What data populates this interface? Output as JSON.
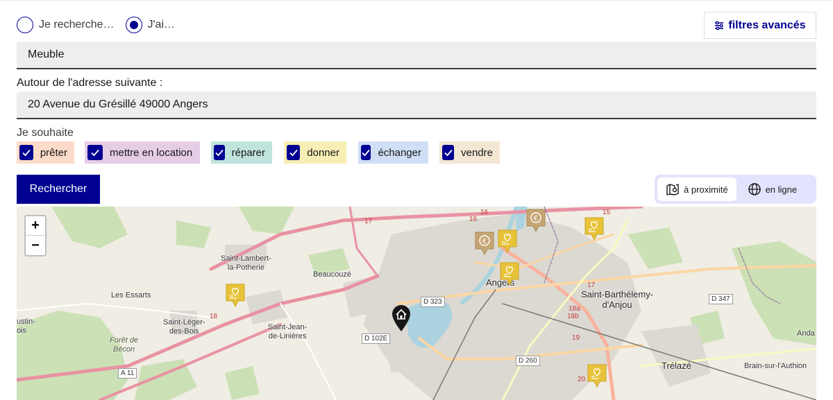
{
  "search": {
    "mode_options": [
      {
        "label": "Je recherche…",
        "selected": false
      },
      {
        "label": "J'ai…",
        "selected": true
      }
    ],
    "advanced_filters_label": "filtres avancés",
    "object_value": "Meuble",
    "address_label": "Autour de l'adresse suivante :",
    "address_value": "20 Avenue du Grésillé 49000 Angers",
    "wish_label": "Je souhaite",
    "actions": [
      {
        "label": "prêter",
        "checked": true,
        "color": "#fcdcc8"
      },
      {
        "label": "mettre en location",
        "checked": true,
        "color": "#e6cde6"
      },
      {
        "label": "réparer",
        "checked": true,
        "color": "#bfe3dd"
      },
      {
        "label": "donner",
        "checked": true,
        "color": "#f6eeb4"
      },
      {
        "label": "échanger",
        "checked": true,
        "color": "#d0dff5"
      },
      {
        "label": "vendre",
        "checked": true,
        "color": "#f3e7d3"
      }
    ],
    "submit_label": "Rechercher"
  },
  "view_toggle": {
    "nearby_label": "à proximité",
    "online_label": "en ligne",
    "active": "nearby"
  },
  "map": {
    "zoom_in": "+",
    "zoom_out": "−",
    "places": {
      "saint_lambert": "Saint-Lambert-\nla-Potherie",
      "beaucouze": "Beaucouzé",
      "les_essarts": "Les Essarts",
      "saint_leger": "Saint-Léger-\ndes-Bois",
      "saint_jean": "Saint-Jean-\nde-Linières",
      "foret": "Forêt de\nBécon",
      "angers": "Angers",
      "saint_barthelemy": "Saint-Barthélemy-\nd'Anjou",
      "trelaze": "Trélazé",
      "brain": "Brain-sur-l'Authion",
      "andard": "Anda",
      "saint_martin": "ustin-\nois"
    },
    "roads": {
      "d323": "D 323",
      "d102e": "D 102E",
      "d260": "D 260",
      "d347": "D 347",
      "a11": "A 11"
    },
    "road_numbers": [
      "17",
      "16",
      "16",
      "15",
      "18",
      "17",
      "18a",
      "18b",
      "19",
      "20"
    ],
    "colors": {
      "marker_gold": "#e8c33a",
      "marker_brown": "#c6a574",
      "home_marker": "#161616"
    },
    "marker_icons": [
      "heart-hand-icon",
      "euro-icon",
      "home-icon"
    ]
  }
}
